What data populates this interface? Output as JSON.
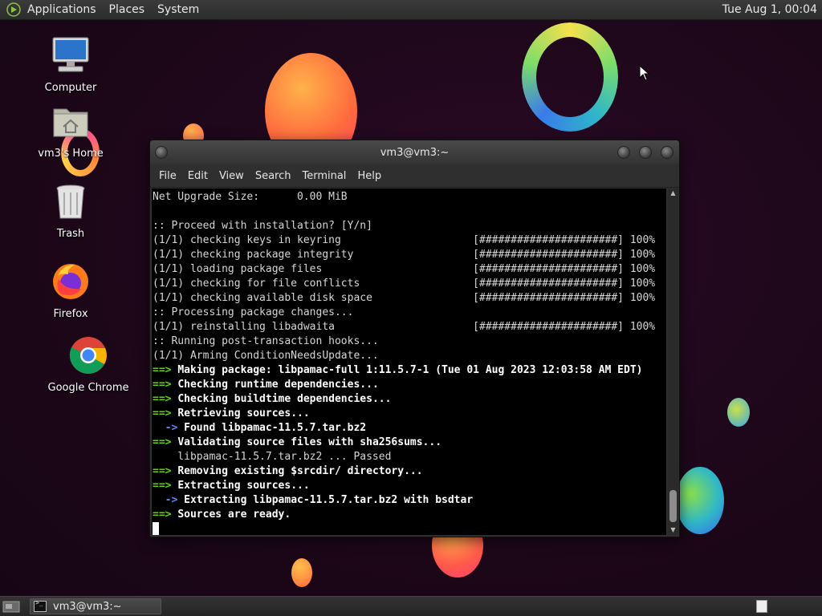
{
  "top_panel": {
    "menus": [
      "Applications",
      "Places",
      "System"
    ],
    "clock": "Tue Aug 1, 00:04"
  },
  "desktop_icons": [
    {
      "label": "Computer",
      "icon": "computer-icon"
    },
    {
      "label": "vm3's Home",
      "icon": "home-folder-icon"
    },
    {
      "label": "Trash",
      "icon": "trash-icon"
    },
    {
      "label": "Firefox",
      "icon": "firefox-icon"
    },
    {
      "label": "Google Chrome",
      "icon": "chrome-icon"
    }
  ],
  "terminal": {
    "title": "vm3@vm3:~",
    "menus": [
      "File",
      "Edit",
      "View",
      "Search",
      "Terminal",
      "Help"
    ],
    "lines": [
      {
        "t": "plain",
        "text": "Net Upgrade Size:      0.00 MiB"
      },
      {
        "t": "plain",
        "text": ""
      },
      {
        "t": "plain",
        "text": ":: Proceed with installation? [Y/n]"
      },
      {
        "t": "plain",
        "text": "(1/1) checking keys in keyring                     [######################] 100%"
      },
      {
        "t": "plain",
        "text": "(1/1) checking package integrity                   [######################] 100%"
      },
      {
        "t": "plain",
        "text": "(1/1) loading package files                        [######################] 100%"
      },
      {
        "t": "plain",
        "text": "(1/1) checking for file conflicts                  [######################] 100%"
      },
      {
        "t": "plain",
        "text": "(1/1) checking available disk space                [######################] 100%"
      },
      {
        "t": "plain",
        "text": ":: Processing package changes..."
      },
      {
        "t": "plain",
        "text": "(1/1) reinstalling libadwaita                      [######################] 100%"
      },
      {
        "t": "plain",
        "text": ":: Running post-transaction hooks..."
      },
      {
        "t": "plain",
        "text": "(1/1) Arming ConditionNeedsUpdate..."
      },
      {
        "t": "arrow",
        "prefix": "==> ",
        "text": "Making package: libpamac-full 1:11.5.7-1 (Tue 01 Aug 2023 12:03:58 AM EDT)"
      },
      {
        "t": "arrow",
        "prefix": "==> ",
        "text": "Checking runtime dependencies..."
      },
      {
        "t": "arrow",
        "prefix": "==> ",
        "text": "Checking buildtime dependencies..."
      },
      {
        "t": "arrow",
        "prefix": "==> ",
        "text": "Retrieving sources..."
      },
      {
        "t": "sub",
        "prefix": "  -> ",
        "text": "Found libpamac-11.5.7.tar.bz2"
      },
      {
        "t": "arrow",
        "prefix": "==> ",
        "text": "Validating source files with sha256sums..."
      },
      {
        "t": "plain",
        "text": "    libpamac-11.5.7.tar.bz2 ... Passed"
      },
      {
        "t": "arrow",
        "prefix": "==> ",
        "text": "Removing existing $srcdir/ directory..."
      },
      {
        "t": "arrow",
        "prefix": "==> ",
        "text": "Extracting sources..."
      },
      {
        "t": "sub",
        "prefix": "  -> ",
        "text": "Extracting libpamac-11.5.7.tar.bz2 with bsdtar"
      },
      {
        "t": "arrow",
        "prefix": "==> ",
        "text": "Sources are ready."
      }
    ]
  },
  "taskbar": {
    "task_label": "vm3@vm3:~"
  },
  "colors": {
    "prompt_arrow": "#5fd700",
    "desktop_bg": "#1d0719"
  }
}
